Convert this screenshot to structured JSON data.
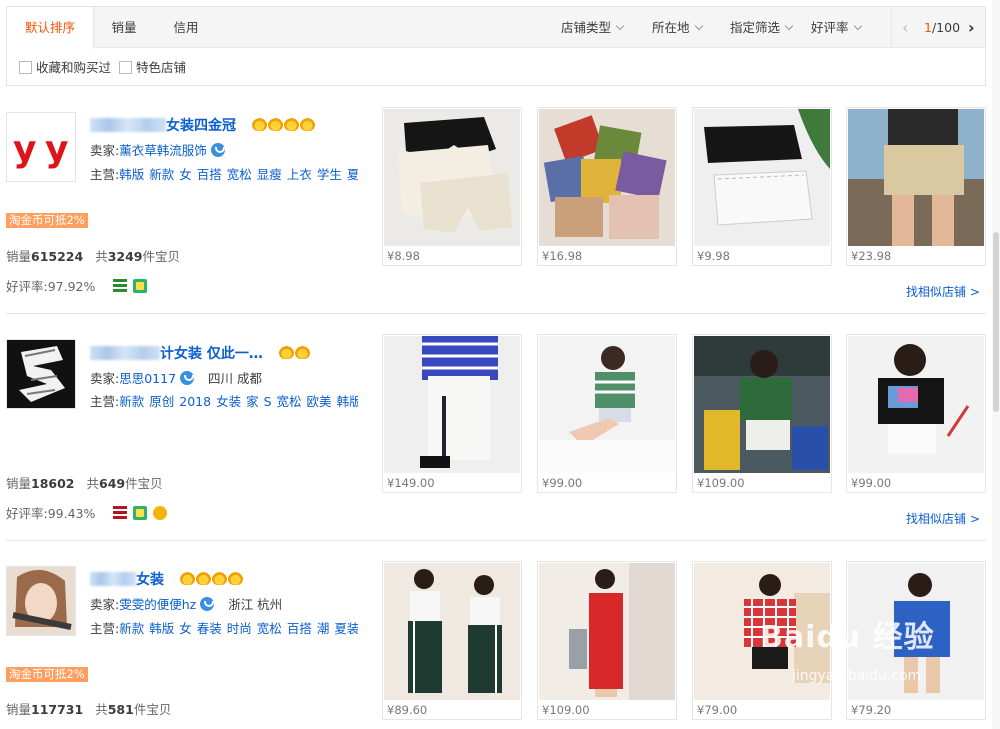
{
  "sort_tabs": [
    {
      "label": "默认排序",
      "active": true
    },
    {
      "label": "销量",
      "active": false
    },
    {
      "label": "信用",
      "active": false
    }
  ],
  "filters": [
    "店铺类型",
    "所在地",
    "指定筛选",
    "好评率"
  ],
  "pager": {
    "prev": "‹",
    "current": "1",
    "total": "/100",
    "next": "›"
  },
  "checkboxes": [
    "收藏和购买过",
    "特色店铺"
  ],
  "labels": {
    "seller_prefix": "卖家:",
    "main_prefix": "主营:",
    "sales_prefix": "销量",
    "count_prefix": "共",
    "count_suffix": "件宝贝",
    "rating_prefix": "好评率:",
    "similar": "找相似店铺 >"
  },
  "shops": [
    {
      "name_suffix": "女装四金冠",
      "crowns": 4,
      "seller": "薰衣草韩流服饰",
      "location": "",
      "main_keywords": [
        "韩版",
        "新款",
        "女",
        "百搭",
        "宽松",
        "显瘦",
        "上衣",
        "学生",
        "夏…"
      ],
      "coin_badge": "淘金币可抵2%",
      "sales": "615224",
      "item_count": "3249",
      "rating": "97.92%",
      "prices": [
        "¥8.98",
        "¥16.98",
        "¥9.98",
        "¥23.98"
      ]
    },
    {
      "name_suffix": "计女装 仅此一…",
      "crowns": 2,
      "seller": "思思0117",
      "location": "四川 成都",
      "main_keywords": [
        "新款",
        "原创",
        "2018",
        "女装",
        "家",
        "S",
        "宽松",
        "欧美",
        "韩版",
        "…"
      ],
      "coin_badge": "",
      "sales": "18602",
      "item_count": "649",
      "rating": "99.43%",
      "prices": [
        "¥149.00",
        "¥99.00",
        "¥109.00",
        "¥99.00"
      ]
    },
    {
      "name_suffix": "女装",
      "crowns": 4,
      "seller": "雯雯的便便hz",
      "location": "浙江 杭州",
      "main_keywords": [
        "新款",
        "韩版",
        "女",
        "春装",
        "时尚",
        "宽松",
        "百搭",
        "潮",
        "夏装",
        "…"
      ],
      "coin_badge": "淘金币可抵2%",
      "sales": "117731",
      "item_count": "581",
      "rating": "",
      "prices": [
        "¥89.60",
        "¥109.00",
        "¥79.00",
        "¥79.20"
      ]
    }
  ],
  "watermark": {
    "line1": "Baidu 经验",
    "line2": "jingyan.baidu.com"
  },
  "colors": {
    "accent": "#ff5000",
    "link": "#0b5fcf",
    "coin_badge": "#ff9e5e",
    "crown": "#f1a000"
  }
}
